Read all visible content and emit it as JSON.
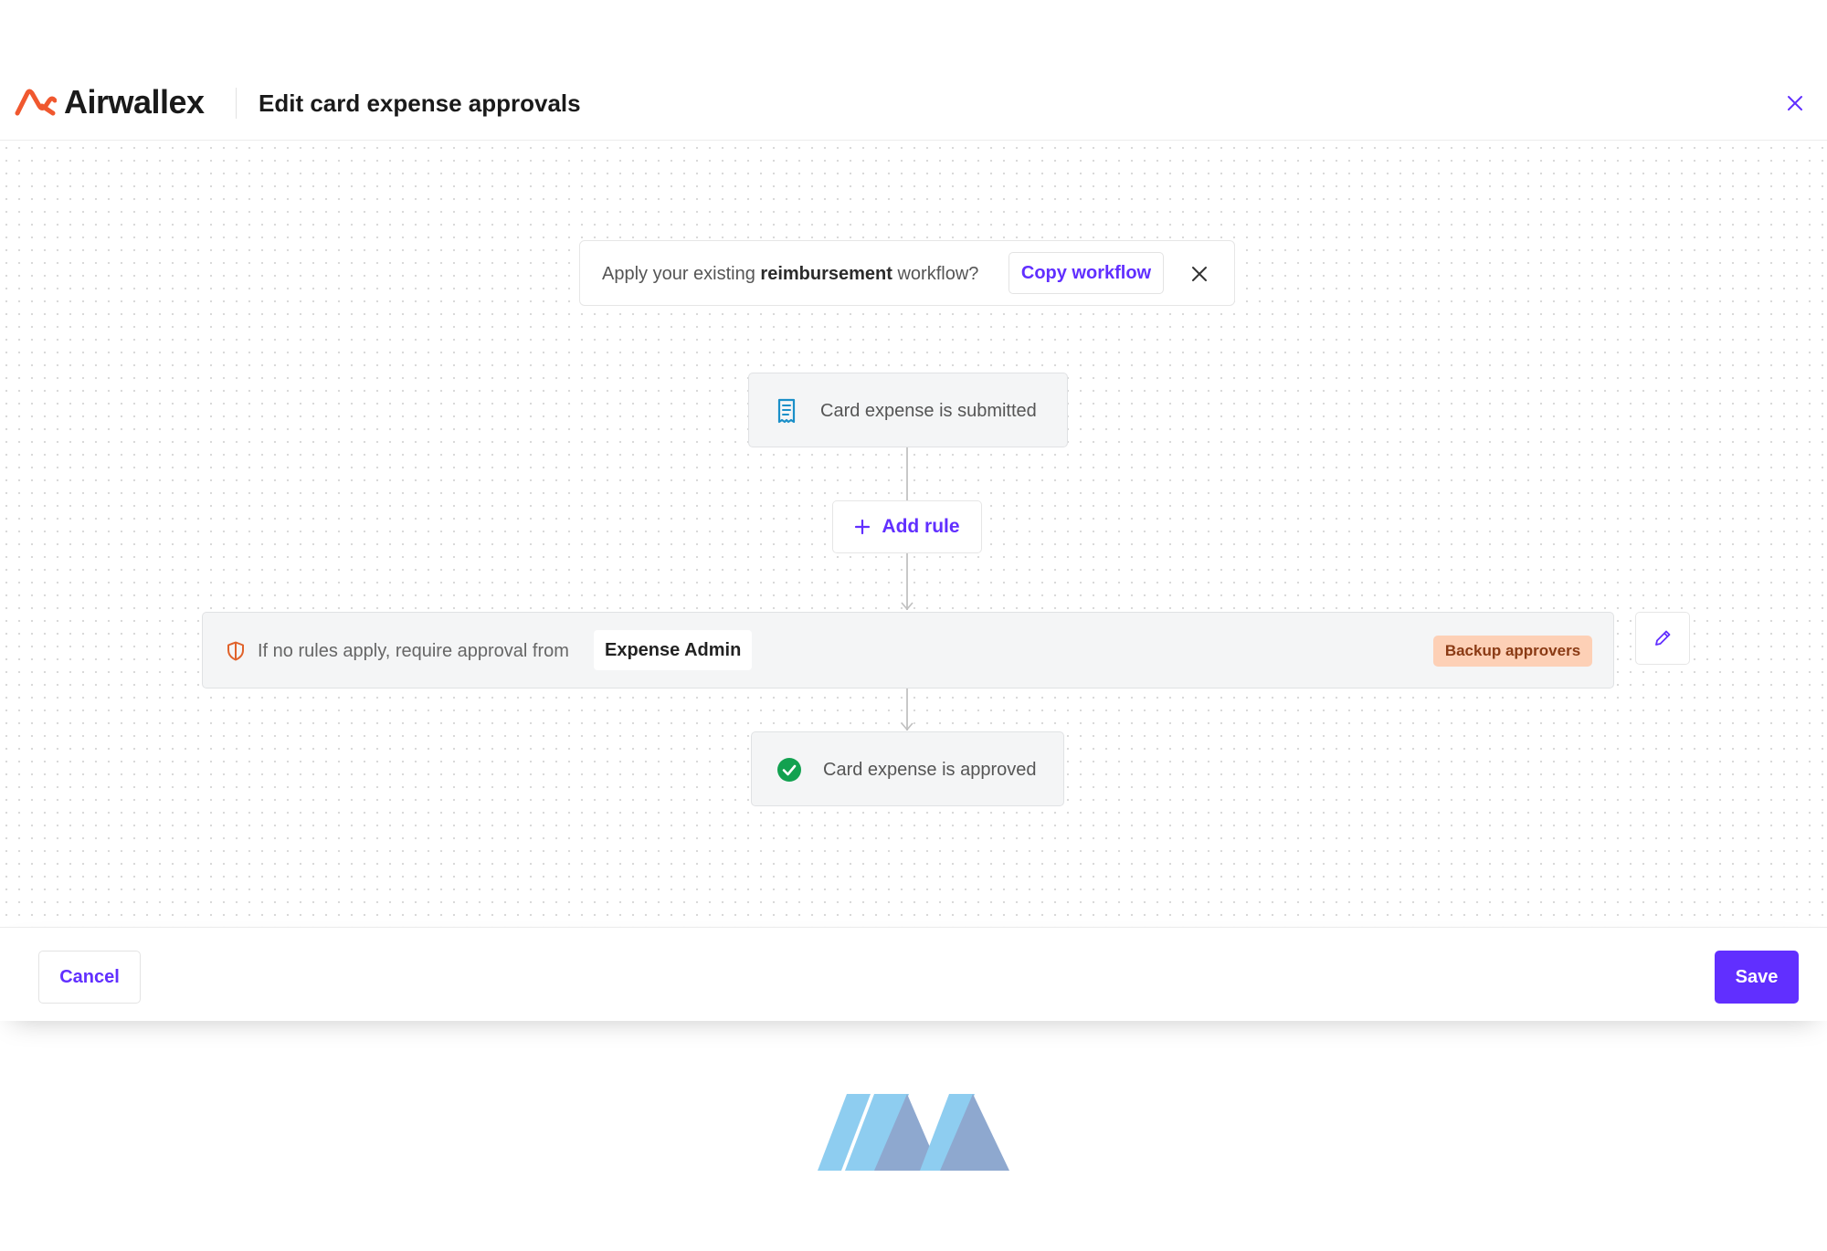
{
  "header": {
    "brand": "Airwallex",
    "title": "Edit card expense approvals",
    "close_icon": "close-icon"
  },
  "banner": {
    "text_before": "Apply your existing ",
    "text_bold": "reimbursement",
    "text_after": " workflow?",
    "copy_button": "Copy workflow",
    "close_icon": "close-icon"
  },
  "workflow": {
    "start_node": {
      "label": "Card expense is submitted",
      "icon": "receipt-icon"
    },
    "add_rule": {
      "label": "Add rule",
      "icon": "plus-icon"
    },
    "default_rule": {
      "text": "If no rules apply, require approval from",
      "approver": "Expense Admin",
      "badge": "Backup approvers",
      "icon": "shield-icon",
      "edit_icon": "pencil-icon"
    },
    "end_node": {
      "label": "Card expense is approved",
      "icon": "check-circle-icon"
    }
  },
  "footer": {
    "cancel_label": "Cancel",
    "save_label": "Save"
  },
  "colors": {
    "accent": "#612fff",
    "brand_orange": "#f0582f",
    "success": "#12a150",
    "info_blue": "#1a8fc8",
    "badge_bg": "#fdd0b6",
    "badge_text": "#8a3a14"
  }
}
